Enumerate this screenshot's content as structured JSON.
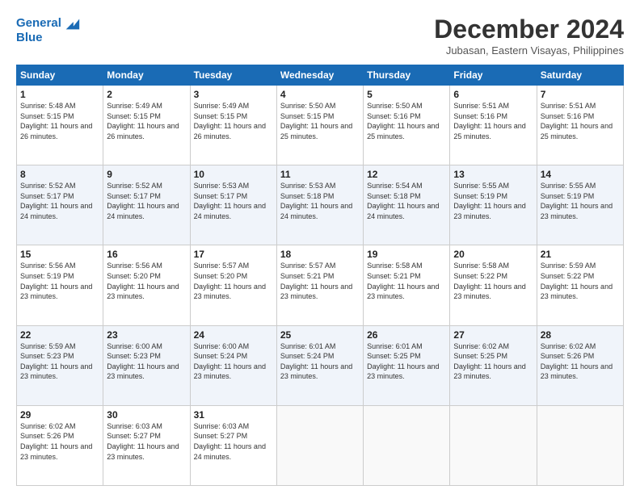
{
  "logo": {
    "line1": "General",
    "line2": "Blue"
  },
  "title": "December 2024",
  "subtitle": "Jubasan, Eastern Visayas, Philippines",
  "days_header": [
    "Sunday",
    "Monday",
    "Tuesday",
    "Wednesday",
    "Thursday",
    "Friday",
    "Saturday"
  ],
  "weeks": [
    [
      {
        "day": "1",
        "sunrise": "5:48 AM",
        "sunset": "5:15 PM",
        "daylight": "11 hours and 26 minutes."
      },
      {
        "day": "2",
        "sunrise": "5:49 AM",
        "sunset": "5:15 PM",
        "daylight": "11 hours and 26 minutes."
      },
      {
        "day": "3",
        "sunrise": "5:49 AM",
        "sunset": "5:15 PM",
        "daylight": "11 hours and 26 minutes."
      },
      {
        "day": "4",
        "sunrise": "5:50 AM",
        "sunset": "5:15 PM",
        "daylight": "11 hours and 25 minutes."
      },
      {
        "day": "5",
        "sunrise": "5:50 AM",
        "sunset": "5:16 PM",
        "daylight": "11 hours and 25 minutes."
      },
      {
        "day": "6",
        "sunrise": "5:51 AM",
        "sunset": "5:16 PM",
        "daylight": "11 hours and 25 minutes."
      },
      {
        "day": "7",
        "sunrise": "5:51 AM",
        "sunset": "5:16 PM",
        "daylight": "11 hours and 25 minutes."
      }
    ],
    [
      {
        "day": "8",
        "sunrise": "5:52 AM",
        "sunset": "5:17 PM",
        "daylight": "11 hours and 24 minutes."
      },
      {
        "day": "9",
        "sunrise": "5:52 AM",
        "sunset": "5:17 PM",
        "daylight": "11 hours and 24 minutes."
      },
      {
        "day": "10",
        "sunrise": "5:53 AM",
        "sunset": "5:17 PM",
        "daylight": "11 hours and 24 minutes."
      },
      {
        "day": "11",
        "sunrise": "5:53 AM",
        "sunset": "5:18 PM",
        "daylight": "11 hours and 24 minutes."
      },
      {
        "day": "12",
        "sunrise": "5:54 AM",
        "sunset": "5:18 PM",
        "daylight": "11 hours and 24 minutes."
      },
      {
        "day": "13",
        "sunrise": "5:55 AM",
        "sunset": "5:19 PM",
        "daylight": "11 hours and 23 minutes."
      },
      {
        "day": "14",
        "sunrise": "5:55 AM",
        "sunset": "5:19 PM",
        "daylight": "11 hours and 23 minutes."
      }
    ],
    [
      {
        "day": "15",
        "sunrise": "5:56 AM",
        "sunset": "5:19 PM",
        "daylight": "11 hours and 23 minutes."
      },
      {
        "day": "16",
        "sunrise": "5:56 AM",
        "sunset": "5:20 PM",
        "daylight": "11 hours and 23 minutes."
      },
      {
        "day": "17",
        "sunrise": "5:57 AM",
        "sunset": "5:20 PM",
        "daylight": "11 hours and 23 minutes."
      },
      {
        "day": "18",
        "sunrise": "5:57 AM",
        "sunset": "5:21 PM",
        "daylight": "11 hours and 23 minutes."
      },
      {
        "day": "19",
        "sunrise": "5:58 AM",
        "sunset": "5:21 PM",
        "daylight": "11 hours and 23 minutes."
      },
      {
        "day": "20",
        "sunrise": "5:58 AM",
        "sunset": "5:22 PM",
        "daylight": "11 hours and 23 minutes."
      },
      {
        "day": "21",
        "sunrise": "5:59 AM",
        "sunset": "5:22 PM",
        "daylight": "11 hours and 23 minutes."
      }
    ],
    [
      {
        "day": "22",
        "sunrise": "5:59 AM",
        "sunset": "5:23 PM",
        "daylight": "11 hours and 23 minutes."
      },
      {
        "day": "23",
        "sunrise": "6:00 AM",
        "sunset": "5:23 PM",
        "daylight": "11 hours and 23 minutes."
      },
      {
        "day": "24",
        "sunrise": "6:00 AM",
        "sunset": "5:24 PM",
        "daylight": "11 hours and 23 minutes."
      },
      {
        "day": "25",
        "sunrise": "6:01 AM",
        "sunset": "5:24 PM",
        "daylight": "11 hours and 23 minutes."
      },
      {
        "day": "26",
        "sunrise": "6:01 AM",
        "sunset": "5:25 PM",
        "daylight": "11 hours and 23 minutes."
      },
      {
        "day": "27",
        "sunrise": "6:02 AM",
        "sunset": "5:25 PM",
        "daylight": "11 hours and 23 minutes."
      },
      {
        "day": "28",
        "sunrise": "6:02 AM",
        "sunset": "5:26 PM",
        "daylight": "11 hours and 23 minutes."
      }
    ],
    [
      {
        "day": "29",
        "sunrise": "6:02 AM",
        "sunset": "5:26 PM",
        "daylight": "11 hours and 23 minutes."
      },
      {
        "day": "30",
        "sunrise": "6:03 AM",
        "sunset": "5:27 PM",
        "daylight": "11 hours and 23 minutes."
      },
      {
        "day": "31",
        "sunrise": "6:03 AM",
        "sunset": "5:27 PM",
        "daylight": "11 hours and 24 minutes."
      },
      null,
      null,
      null,
      null
    ]
  ]
}
